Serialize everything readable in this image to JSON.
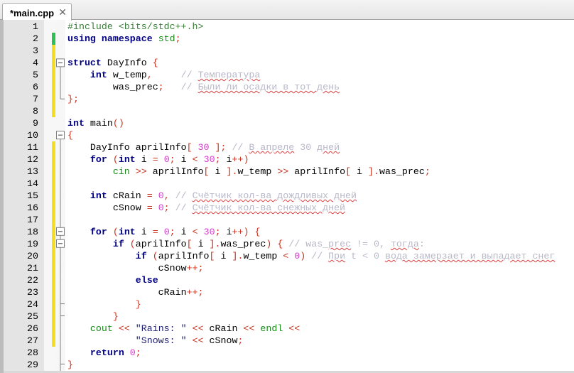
{
  "tab": {
    "title": "*main.cpp",
    "close": "✕"
  },
  "code": {
    "lines": [
      {
        "n": "1",
        "bar": "",
        "tokens": [
          [
            "p",
            "#include <bits/stdc++.h>"
          ]
        ]
      },
      {
        "n": "2",
        "bar": "#2ec050",
        "tokens": [
          [
            "k",
            "using"
          ],
          [
            "t",
            " "
          ],
          [
            "k",
            "namespace"
          ],
          [
            "t",
            " "
          ],
          [
            "g",
            "std"
          ],
          [
            "o",
            ";"
          ]
        ]
      },
      {
        "n": "3",
        "bar": "#f0e020",
        "tokens": []
      },
      {
        "n": "4",
        "bar": "#f0e020",
        "tokens": [
          [
            "k",
            "struct"
          ],
          [
            "t",
            " DayInfo "
          ],
          [
            "o",
            "{"
          ]
        ]
      },
      {
        "n": "5",
        "bar": "#f0e020",
        "tokens": [
          [
            "t",
            "    "
          ],
          [
            "k",
            "int"
          ],
          [
            "t",
            " w_temp"
          ],
          [
            "o",
            ","
          ],
          [
            "t",
            "     "
          ],
          [
            "c",
            "// "
          ],
          [
            "cu",
            "Температура"
          ]
        ]
      },
      {
        "n": "6",
        "bar": "#f0e020",
        "tokens": [
          [
            "t",
            "        was_prec"
          ],
          [
            "o",
            ";"
          ],
          [
            "t",
            "   "
          ],
          [
            "c",
            "// "
          ],
          [
            "cu",
            "Были ли осадки в тот день"
          ]
        ]
      },
      {
        "n": "7",
        "bar": "#f0e020",
        "tokens": [
          [
            "o",
            "};"
          ]
        ]
      },
      {
        "n": "8",
        "bar": "#f0e020",
        "tokens": []
      },
      {
        "n": "9",
        "bar": "",
        "tokens": [
          [
            "k",
            "int"
          ],
          [
            "t",
            " main"
          ],
          [
            "o",
            "()"
          ]
        ]
      },
      {
        "n": "10",
        "bar": "",
        "tokens": [
          [
            "o",
            "{"
          ]
        ]
      },
      {
        "n": "11",
        "bar": "#f0e020",
        "tokens": [
          [
            "t",
            "    DayInfo aprilInfo"
          ],
          [
            "o",
            "["
          ],
          [
            "t",
            " "
          ],
          [
            "n",
            "30"
          ],
          [
            "t",
            " "
          ],
          [
            "o",
            "];"
          ],
          [
            "t",
            " "
          ],
          [
            "c",
            "// "
          ],
          [
            "cu",
            "В апреле"
          ],
          [
            "c",
            " 30 "
          ],
          [
            "cu",
            "дней"
          ]
        ]
      },
      {
        "n": "12",
        "bar": "#f0e020",
        "tokens": [
          [
            "t",
            "    "
          ],
          [
            "k",
            "for"
          ],
          [
            "t",
            " "
          ],
          [
            "o",
            "("
          ],
          [
            "k",
            "int"
          ],
          [
            "t",
            " i "
          ],
          [
            "o",
            "="
          ],
          [
            "t",
            " "
          ],
          [
            "n",
            "0"
          ],
          [
            "o",
            ";"
          ],
          [
            "t",
            " i "
          ],
          [
            "o",
            "<"
          ],
          [
            "t",
            " "
          ],
          [
            "n",
            "30"
          ],
          [
            "o",
            ";"
          ],
          [
            "t",
            " i"
          ],
          [
            "o",
            "++)"
          ]
        ]
      },
      {
        "n": "13",
        "bar": "#f0e020",
        "tokens": [
          [
            "t",
            "        "
          ],
          [
            "g",
            "cin"
          ],
          [
            "t",
            " "
          ],
          [
            "o",
            ">>"
          ],
          [
            "t",
            " aprilInfo"
          ],
          [
            "o",
            "["
          ],
          [
            "t",
            " i "
          ],
          [
            "o",
            "]."
          ],
          [
            "t",
            "w_temp "
          ],
          [
            "o",
            ">>"
          ],
          [
            "t",
            " aprilInfo"
          ],
          [
            "o",
            "["
          ],
          [
            "t",
            " i "
          ],
          [
            "o",
            "]."
          ],
          [
            "t",
            "was_prec"
          ],
          [
            "o",
            ";"
          ]
        ]
      },
      {
        "n": "14",
        "bar": "#f0e020",
        "tokens": []
      },
      {
        "n": "15",
        "bar": "#f0e020",
        "tokens": [
          [
            "t",
            "    "
          ],
          [
            "k",
            "int"
          ],
          [
            "t",
            " cRain "
          ],
          [
            "o",
            "="
          ],
          [
            "t",
            " "
          ],
          [
            "n",
            "0"
          ],
          [
            "o",
            ","
          ],
          [
            "t",
            " "
          ],
          [
            "c",
            "// "
          ],
          [
            "cu",
            "Счётчик кол-ва дождливых дней"
          ]
        ]
      },
      {
        "n": "16",
        "bar": "#f0e020",
        "tokens": [
          [
            "t",
            "        cSnow "
          ],
          [
            "o",
            "="
          ],
          [
            "t",
            " "
          ],
          [
            "n",
            "0"
          ],
          [
            "o",
            ";"
          ],
          [
            "t",
            " "
          ],
          [
            "c",
            "// "
          ],
          [
            "cu",
            "Счётчик кол-ва снежных дней"
          ]
        ]
      },
      {
        "n": "17",
        "bar": "#f0e020",
        "tokens": []
      },
      {
        "n": "18",
        "bar": "#f0e020",
        "tokens": [
          [
            "t",
            "    "
          ],
          [
            "k",
            "for"
          ],
          [
            "t",
            " "
          ],
          [
            "o",
            "("
          ],
          [
            "k",
            "int"
          ],
          [
            "t",
            " i "
          ],
          [
            "o",
            "="
          ],
          [
            "t",
            " "
          ],
          [
            "n",
            "0"
          ],
          [
            "o",
            ";"
          ],
          [
            "t",
            " i "
          ],
          [
            "o",
            "<"
          ],
          [
            "t",
            " "
          ],
          [
            "n",
            "30"
          ],
          [
            "o",
            ";"
          ],
          [
            "t",
            " i"
          ],
          [
            "o",
            "++)"
          ],
          [
            "t",
            " "
          ],
          [
            "o",
            "{"
          ]
        ]
      },
      {
        "n": "19",
        "bar": "#f0e020",
        "tokens": [
          [
            "t",
            "        "
          ],
          [
            "k",
            "if"
          ],
          [
            "t",
            " "
          ],
          [
            "o",
            "("
          ],
          [
            "t",
            "aprilInfo"
          ],
          [
            "o",
            "["
          ],
          [
            "t",
            " i "
          ],
          [
            "o",
            "]."
          ],
          [
            "t",
            "was_prec"
          ],
          [
            "o",
            ")"
          ],
          [
            "t",
            " "
          ],
          [
            "o",
            "{"
          ],
          [
            "t",
            " "
          ],
          [
            "c",
            "// was_"
          ],
          [
            "cu",
            "prec"
          ],
          [
            "c",
            " != 0, "
          ],
          [
            "cu",
            "тогда"
          ],
          [
            "c",
            ":"
          ]
        ]
      },
      {
        "n": "20",
        "bar": "#f0e020",
        "tokens": [
          [
            "t",
            "            "
          ],
          [
            "k",
            "if"
          ],
          [
            "t",
            " "
          ],
          [
            "o",
            "("
          ],
          [
            "t",
            "aprilInfo"
          ],
          [
            "o",
            "["
          ],
          [
            "t",
            " i "
          ],
          [
            "o",
            "]."
          ],
          [
            "t",
            "w_temp "
          ],
          [
            "o",
            "<"
          ],
          [
            "t",
            " "
          ],
          [
            "n",
            "0"
          ],
          [
            "o",
            ")"
          ],
          [
            "t",
            " "
          ],
          [
            "c",
            "// "
          ],
          [
            "cu",
            "При"
          ],
          [
            "c",
            " t < 0 "
          ],
          [
            "cu",
            "вода замерзает и выпадает снег"
          ]
        ]
      },
      {
        "n": "21",
        "bar": "#f0e020",
        "tokens": [
          [
            "t",
            "                cSnow"
          ],
          [
            "o",
            "++;"
          ]
        ]
      },
      {
        "n": "22",
        "bar": "#f0e020",
        "tokens": [
          [
            "t",
            "            "
          ],
          [
            "k",
            "else"
          ]
        ]
      },
      {
        "n": "23",
        "bar": "#f0e020",
        "tokens": [
          [
            "t",
            "                cRain"
          ],
          [
            "o",
            "++;"
          ]
        ]
      },
      {
        "n": "24",
        "bar": "#f0e020",
        "tokens": [
          [
            "t",
            "            "
          ],
          [
            "o",
            "}"
          ]
        ]
      },
      {
        "n": "25",
        "bar": "#f0e020",
        "tokens": [
          [
            "t",
            "        "
          ],
          [
            "o",
            "}"
          ]
        ]
      },
      {
        "n": "26",
        "bar": "#f0e020",
        "tokens": [
          [
            "t",
            "    "
          ],
          [
            "g",
            "cout"
          ],
          [
            "t",
            " "
          ],
          [
            "o",
            "<<"
          ],
          [
            "t",
            " "
          ],
          [
            "s",
            "\"Rains: \""
          ],
          [
            "t",
            " "
          ],
          [
            "o",
            "<<"
          ],
          [
            "t",
            " cRain "
          ],
          [
            "o",
            "<<"
          ],
          [
            "t",
            " "
          ],
          [
            "g",
            "endl"
          ],
          [
            "t",
            " "
          ],
          [
            "o",
            "<<"
          ]
        ]
      },
      {
        "n": "27",
        "bar": "#f0e020",
        "tokens": [
          [
            "t",
            "            "
          ],
          [
            "s",
            "\"Snows: \""
          ],
          [
            "t",
            " "
          ],
          [
            "o",
            "<<"
          ],
          [
            "t",
            " cSnow"
          ],
          [
            "o",
            ";"
          ]
        ]
      },
      {
        "n": "28",
        "bar": "",
        "tokens": [
          [
            "t",
            "    "
          ],
          [
            "k",
            "return"
          ],
          [
            "t",
            " "
          ],
          [
            "n",
            "0"
          ],
          [
            "o",
            ";"
          ]
        ]
      },
      {
        "n": "29",
        "bar": "",
        "tokens": [
          [
            "o",
            "}"
          ]
        ]
      }
    ]
  }
}
